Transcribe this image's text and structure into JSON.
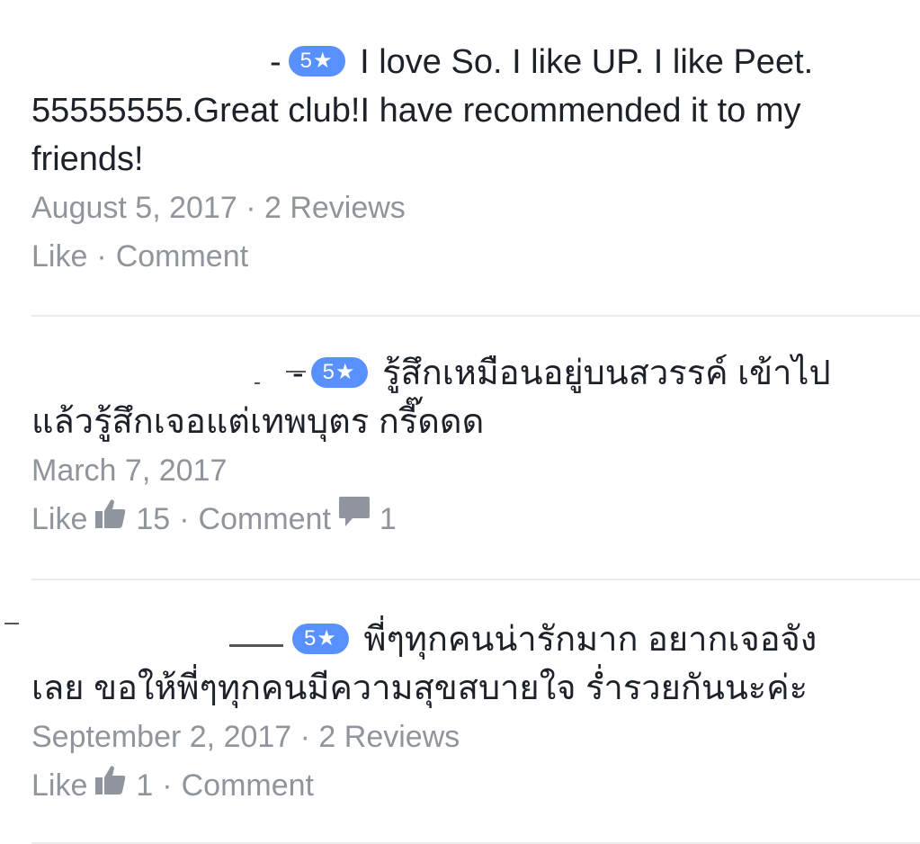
{
  "reviews": [
    {
      "rating": "5★",
      "text_line1": "I love So. I like UP. I like Peet.",
      "text_rest": "55555555.Great club!I have recommended it to my friends!",
      "date": "August 5, 2017",
      "reviews_count": "2 Reviews",
      "like_label": "Like",
      "comment_label": "Comment"
    },
    {
      "rating": "5★",
      "text_line1": "รู้สึกเหมือนอยู่บนสวรรค์ เข้าไป",
      "text_rest": "แล้วรู้สึกเจอแต่เทพบุตร กรี๊ดดด",
      "date": "March 7, 2017",
      "like_label": "Like",
      "like_count": "15",
      "comment_label": "Comment",
      "comment_count": "1"
    },
    {
      "rating": "5★",
      "text_line1": "พี่ๆทุกคนน่ารักมาก อยากเจอจัง",
      "text_rest": "เลย ขอให้พี่ๆทุกคนมีความสุขสบายใจ ร่ำรวยกันนะค่ะ",
      "date": "September 2, 2017",
      "reviews_count": "2 Reviews",
      "like_label": "Like",
      "like_count": "1",
      "comment_label": "Comment"
    }
  ],
  "colors": {
    "badge": "#5890ff",
    "meta_text": "#90949c",
    "body_text": "#1d2129",
    "divider": "#e9ebee"
  }
}
